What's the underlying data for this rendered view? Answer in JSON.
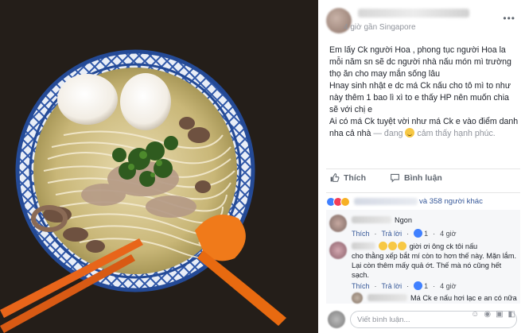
{
  "post": {
    "meta": "4 giờ  gần Singapore",
    "more_icon": "more-options-icon",
    "paragraphs": [
      "Em lấy Ck người Hoa , phong tục người Hoa la mỗi năm sn sẽ dc người nhà nấu món mì trường thọ ăn cho may mắn sống lâu",
      "Hnay sinh nhật e dc má Ck nấu cho tô mì to như này thêm 1 bao lì xì to e thấy HP nên muốn chia sẽ với chị e",
      "Ai có má Ck tuyệt vời như má Ck e vào điểm danh nha cả nhà"
    ],
    "feeling_prefix": " — đang ",
    "feeling_text": " cảm thấy hạnh phúc."
  },
  "actions": {
    "like_label": "Thích",
    "comment_label": "Bình luận"
  },
  "reactions": {
    "others": "và 358 người khác",
    "types": [
      "like",
      "love",
      "wow"
    ]
  },
  "comments": [
    {
      "text": "Ngon",
      "action_like": "Thích",
      "action_reply": "Trả lời",
      "likes": "1",
      "time": "4 giờ"
    },
    {
      "text_line1": "giời ơi ông ck tôi nấu",
      "text_line2": "cho thằng xếp bắt mí còn to hơn thế này. Mặn lắm.",
      "text_line3": "Lại còn thêm mấy quả ớt. Thế mà nó cũng hết",
      "text_line4": "sạch.",
      "action_like": "Thích",
      "action_reply": "Trả lời",
      "likes": "1",
      "time": "4 giờ"
    },
    {
      "text": "Má Ck e nấu hơi lạc e an có nữa"
    }
  ],
  "composer": {
    "placeholder": "Viết bình luận..."
  },
  "colors": {
    "fb_blue": "#365899",
    "like_blue": "#4080ff",
    "love_red": "#f33e58",
    "wow_yellow": "#f7b125",
    "muted_gray": "#90949c"
  }
}
